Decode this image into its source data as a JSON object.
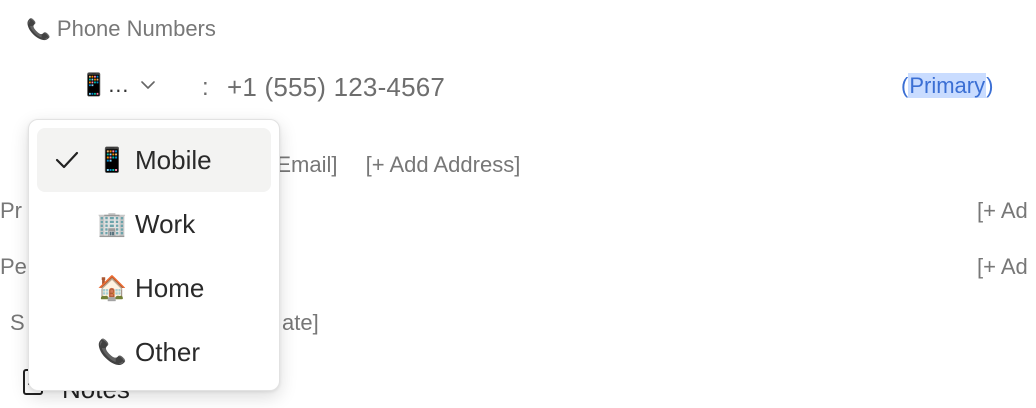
{
  "section": {
    "icon": "phone-icon",
    "title": "Phone Numbers"
  },
  "phone_row": {
    "type_display": "📱…",
    "separator": ":",
    "number": "+1 (555) 123-4567",
    "tag_open": "(",
    "tag_label": "Primary",
    "tag_close": ")"
  },
  "background": {
    "add_email": "d Email]",
    "add_address": "[+ Add Address]",
    "row_pr": "Pr",
    "row_pe": "Pe",
    "row_s": "S",
    "row_ate": "ate]",
    "right_add_1": "[+ Ad",
    "right_add_2": "[+ Ad",
    "notes_partial": "Notes",
    "notes_dot": "·"
  },
  "dropdown": {
    "items": [
      {
        "icon": "mobile-phone-icon",
        "emoji": "📱",
        "label": "Mobile",
        "selected": true
      },
      {
        "icon": "office-building-icon",
        "emoji": "🏢",
        "label": "Work",
        "selected": false
      },
      {
        "icon": "house-icon",
        "emoji": "🏠",
        "label": "Home",
        "selected": false
      },
      {
        "icon": "telephone-icon",
        "emoji": "📞",
        "label": "Other",
        "selected": false
      }
    ]
  },
  "colors": {
    "accent": "#3b6fd4",
    "highlight": "#c9dcff",
    "selected_bg": "#f3f3f2"
  }
}
